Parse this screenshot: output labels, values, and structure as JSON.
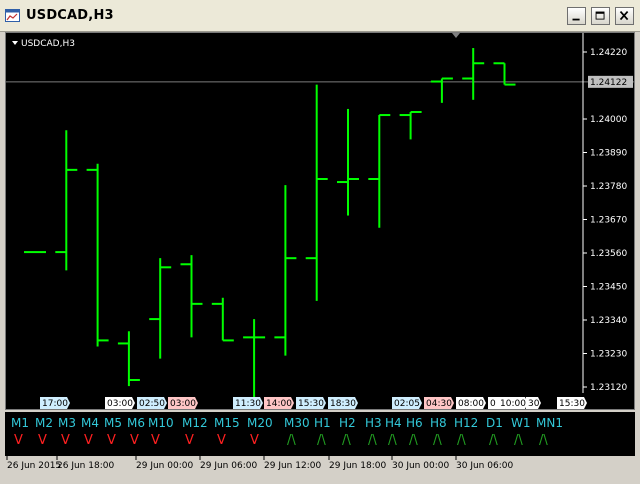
{
  "window": {
    "title": "USDCAD,H3"
  },
  "chart": {
    "symbol_label": "USDCAD,H3",
    "current_price": "1.24122",
    "price_ticks": [
      "1.24220",
      "1.24000",
      "1.23890",
      "1.23780",
      "1.23670",
      "1.23560",
      "1.23450",
      "1.23340",
      "1.23230",
      "1.23120"
    ],
    "time_axis": [
      "26 Jun 2015",
      "26 Jun 18:00",
      "29 Jun 00:00",
      "29 Jun 06:00",
      "29 Jun 12:00",
      "29 Jun 18:00",
      "30 Jun 00:00",
      "30 Jun 06:00"
    ],
    "colors": {
      "bar": "#00ff00",
      "background": "#000000",
      "text": "#ffffff",
      "price_line": "#808080"
    }
  },
  "chart_data": {
    "type": "ohlc",
    "bars": [
      {
        "o": 1.23563,
        "h": 1.23563,
        "l": 1.23563,
        "c": 1.23563
      },
      {
        "o": 1.23563,
        "h": 1.23963,
        "l": 1.23503,
        "c": 1.23833
      },
      {
        "o": 1.23833,
        "h": 1.23853,
        "l": 1.23253,
        "c": 1.23273
      },
      {
        "o": 1.23263,
        "h": 1.23303,
        "l": 1.23123,
        "c": 1.23143
      },
      {
        "o": 1.23343,
        "h": 1.23543,
        "l": 1.23213,
        "c": 1.23513
      },
      {
        "o": 1.23523,
        "h": 1.23553,
        "l": 1.23283,
        "c": 1.23393
      },
      {
        "o": 1.23393,
        "h": 1.23413,
        "l": 1.23273,
        "c": 1.23273
      },
      {
        "o": 1.23283,
        "h": 1.23343,
        "l": 1.23083,
        "c": 1.23283
      },
      {
        "o": 1.23283,
        "h": 1.23783,
        "l": 1.23223,
        "c": 1.23543
      },
      {
        "o": 1.23543,
        "h": 1.24113,
        "l": 1.23403,
        "c": 1.23803
      },
      {
        "o": 1.23793,
        "h": 1.24033,
        "l": 1.23683,
        "c": 1.23803
      },
      {
        "o": 1.23803,
        "h": 1.23803,
        "l": 1.23643,
        "c": 1.24013
      },
      {
        "o": 1.24013,
        "h": 1.24023,
        "l": 1.23933,
        "c": 1.24023
      },
      {
        "o": 1.24123,
        "h": 1.24133,
        "l": 1.24053,
        "c": 1.24133
      },
      {
        "o": 1.24133,
        "h": 1.24233,
        "l": 1.24063,
        "c": 1.24183
      },
      {
        "o": 1.24183,
        "h": 1.24183,
        "l": 1.24113,
        "c": 1.24113
      }
    ]
  },
  "session_labels": [
    {
      "text": "17:00",
      "color": "#cfeefe"
    },
    {
      "text": "03:00",
      "color": "#ffffff"
    },
    {
      "text": "02:50",
      "color": "#cfeefe"
    },
    {
      "text": "03:00",
      "color": "#ffc6c6"
    },
    {
      "text": "11:30",
      "color": "#cfeefe"
    },
    {
      "text": "14:00",
      "color": "#ffc6c6"
    },
    {
      "text": "15:30",
      "color": "#cfeefe"
    },
    {
      "text": "18:30",
      "color": "#cfeefe"
    },
    {
      "text": "02:05",
      "color": "#cfeefe"
    },
    {
      "text": "04:30",
      "color": "#ffc6c6"
    },
    {
      "text": "08:00",
      "color": "#ffffff"
    },
    {
      "text": "0",
      "color": "#ffffff"
    },
    {
      "text": "10:00",
      "color": "#ffffff"
    },
    {
      "text": "30",
      "color": "#ffffff"
    },
    {
      "text": "15:30",
      "color": "#ffffff"
    }
  ],
  "timeframes": [
    {
      "label": "M1",
      "dir": "V"
    },
    {
      "label": "M2",
      "dir": "V"
    },
    {
      "label": "M3",
      "dir": "V"
    },
    {
      "label": "M4",
      "dir": "V"
    },
    {
      "label": "M5",
      "dir": "V"
    },
    {
      "label": "M6",
      "dir": "V"
    },
    {
      "label": "M10",
      "dir": "V"
    },
    {
      "label": "M12",
      "dir": "V"
    },
    {
      "label": "M15",
      "dir": "V"
    },
    {
      "label": "M20",
      "dir": "V"
    },
    {
      "label": "M30",
      "dir": "/\\"
    },
    {
      "label": "H1",
      "dir": "/\\"
    },
    {
      "label": "H2",
      "dir": "/\\"
    },
    {
      "label": "H3",
      "dir": "/\\"
    },
    {
      "label": "H4",
      "dir": "/\\"
    },
    {
      "label": "H6",
      "dir": "/\\"
    },
    {
      "label": "H8",
      "dir": "/\\"
    },
    {
      "label": "H12",
      "dir": "/\\"
    },
    {
      "label": "D1",
      "dir": "/\\"
    },
    {
      "label": "W1",
      "dir": "/\\"
    },
    {
      "label": "MN1",
      "dir": "/\\"
    }
  ]
}
